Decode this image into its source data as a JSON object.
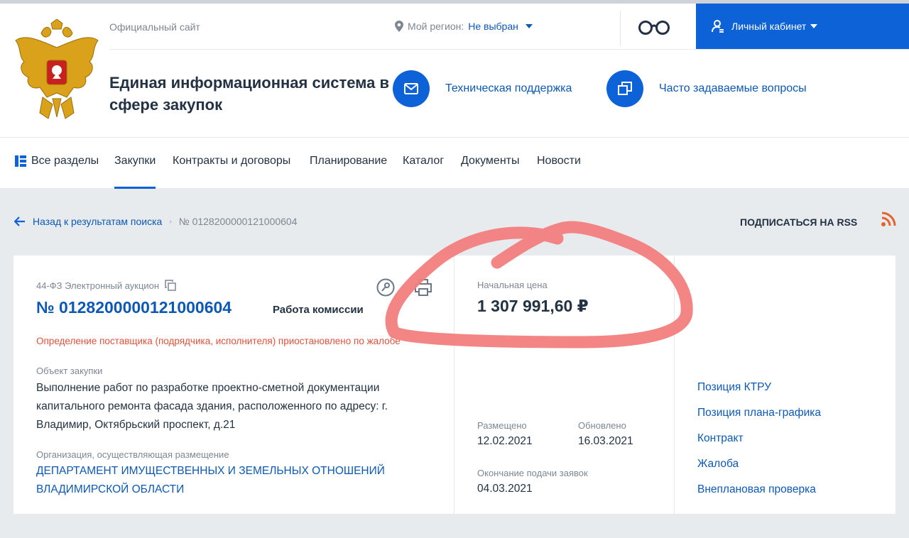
{
  "header": {
    "official": "Официальный сайт",
    "region_label": "Мой регион:",
    "region_value": "Не выбран",
    "cabinet": "Личный кабинет",
    "site_title": "Единая информационная система в сфере закупок",
    "support": "Техническая поддержка",
    "faq": "Часто задаваемые вопросы"
  },
  "nav": {
    "all": "Все разделы",
    "items": [
      "Закупки",
      "Контракты и договоры",
      "Планирование",
      "Каталог",
      "Документы",
      "Новости"
    ]
  },
  "breadcrumb": {
    "back": "Назад к результатам поиска",
    "current": "№ 0128200000121000604"
  },
  "rss": "ПОДПИСАТЬСЯ НА RSS",
  "card": {
    "type": "44-ФЗ Электронный аукцион",
    "number": "№ 0128200000121000604",
    "stage": "Работа комиссии",
    "warning": "Определение поставщика (подрядчика, исполнителя) приостановлено по жалобе",
    "object_label": "Объект закупки",
    "object_text": "Выполнение работ по разработке проектно-сметной документации капитального ремонта фасада здания, расположенного по адресу: г. Владимир, Октябрьский проспект, д.21",
    "org_label": "Организация, осуществляющая размещение",
    "org_text": "ДЕПАРТАМЕНТ ИМУЩЕСТВЕННЫХ И ЗЕМЕЛЬНЫХ ОТНОШЕНИЙ ВЛАДИМИРСКОЙ ОБЛАСТИ",
    "price_label": "Начальная цена",
    "price": "1 307 991,60 ₽",
    "posted_label": "Размещено",
    "posted": "12.02.2021",
    "updated_label": "Обновлено",
    "updated": "16.03.2021",
    "end_label": "Окончание подачи заявок",
    "end": "04.03.2021",
    "links": [
      "Позиция КТРУ",
      "Позиция плана-графика",
      "Контракт",
      "Жалоба",
      "Внеплановая проверка"
    ]
  },
  "colors": {
    "accent": "#0d62d8",
    "link": "#0d58b7",
    "warning": "#e2533c",
    "annotation": "#f27e7e"
  }
}
